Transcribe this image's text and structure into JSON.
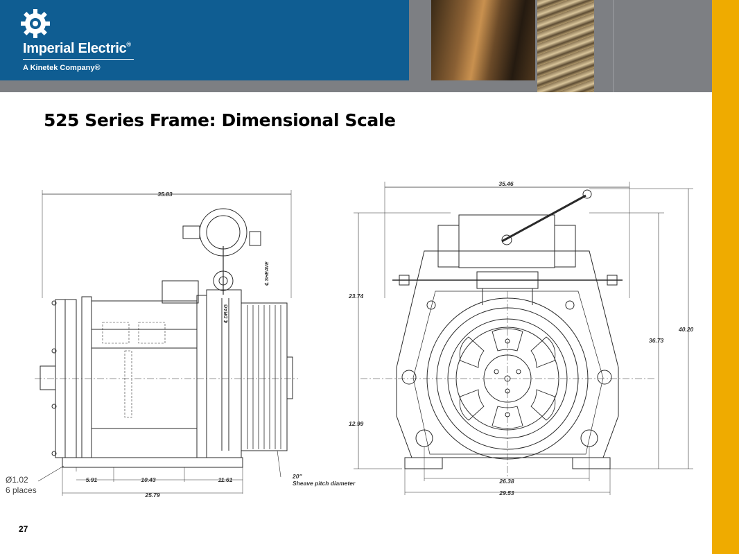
{
  "brand": {
    "name": "Imperial Electric",
    "registered": "®",
    "subtitle": "A Kinetek Company®"
  },
  "title": "525 Series Frame: Dimensional Scale",
  "page_number": "27",
  "side_view": {
    "overall_length": "35.83",
    "bolt_callout_1": "Ø1.02",
    "bolt_callout_2": "6 places",
    "dim_a": "5.91",
    "dim_b": "10.43",
    "dim_c": "11.61",
    "base_length": "25.79",
    "sheave_value": "20\"",
    "sheave_label": "Sheave pitch diameter",
    "cl_sheave": "℄ SHEAVE",
    "cl_drag": "℄ DRAG"
  },
  "front_view": {
    "overall_width": "35.46",
    "left_upper": "23.74",
    "left_lower": "12.99",
    "right_inner": "36.73",
    "right_outer": "40.20",
    "base_inner": "26.38",
    "base_outer": "29.53"
  }
}
